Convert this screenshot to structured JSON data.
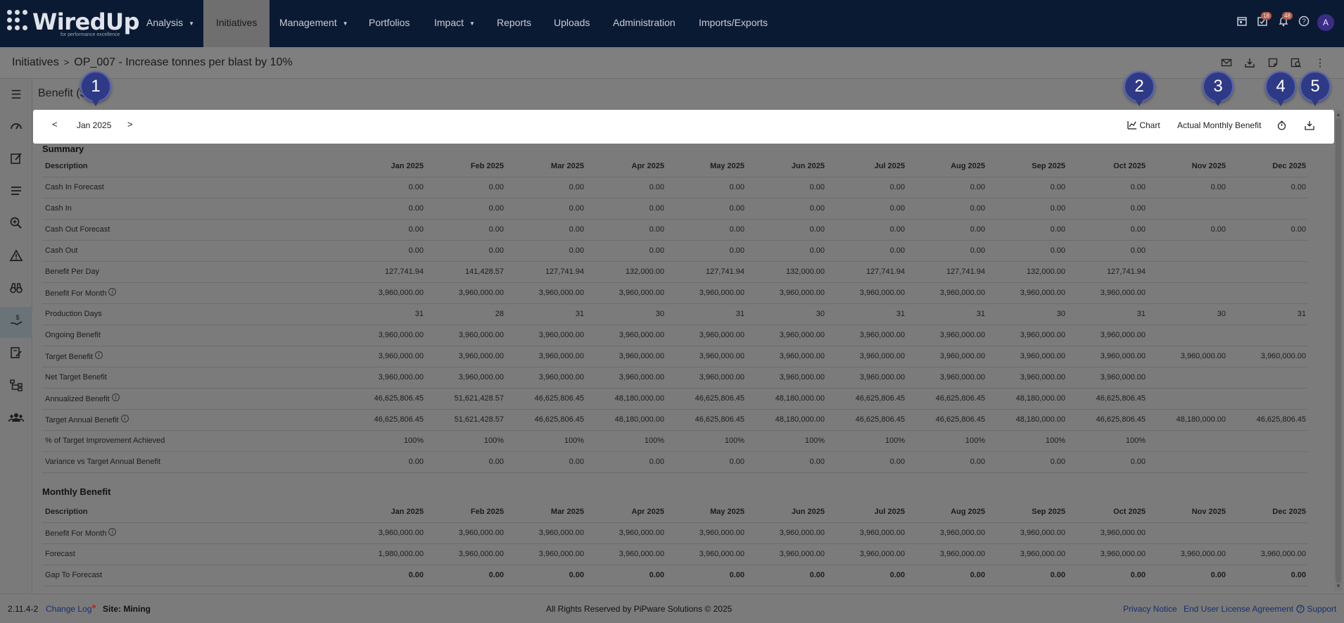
{
  "nav": {
    "logo": "WiredUp",
    "logo_tagline": "for performance excellence",
    "items": [
      {
        "label": "Analysis",
        "dropdown": true
      },
      {
        "label": "Initiatives",
        "active": true
      },
      {
        "label": "Management",
        "dropdown": true
      },
      {
        "label": "Portfolios"
      },
      {
        "label": "Impact",
        "dropdown": true
      },
      {
        "label": "Reports"
      },
      {
        "label": "Uploads"
      },
      {
        "label": "Administration"
      },
      {
        "label": "Imports/Exports"
      }
    ],
    "icons": [
      "calendar-icon",
      "tasks-icon",
      "bell-icon",
      "help-icon"
    ],
    "tasks_badge": "18",
    "notifications_badge": "48",
    "avatar_initial": "A"
  },
  "breadcrumb": {
    "root": "Initiatives",
    "current": "OP_007 - Increase tonnes per blast by 10%"
  },
  "panel_title": "Benefit ($)",
  "toolbar": {
    "period": "Jan 2025",
    "chart_label": "Chart",
    "view_label": "Actual Monthly Benefit"
  },
  "markers": [
    "1",
    "2",
    "3",
    "4",
    "5"
  ],
  "summary": {
    "title": "Summary",
    "description_header": "Description",
    "months": [
      "Jan 2025",
      "Feb 2025",
      "Mar 2025",
      "Apr 2025",
      "May 2025",
      "Jun 2025",
      "Jul 2025",
      "Aug 2025",
      "Sep 2025",
      "Oct 2025",
      "Nov 2025",
      "Dec 2025"
    ],
    "rows": [
      {
        "label": "Cash In Forecast",
        "info": false,
        "values": [
          "0.00",
          "0.00",
          "0.00",
          "0.00",
          "0.00",
          "0.00",
          "0.00",
          "0.00",
          "0.00",
          "0.00",
          "0.00",
          "0.00"
        ]
      },
      {
        "label": "Cash In",
        "info": false,
        "values": [
          "0.00",
          "0.00",
          "0.00",
          "0.00",
          "0.00",
          "0.00",
          "0.00",
          "0.00",
          "0.00",
          "0.00",
          "",
          ""
        ]
      },
      {
        "label": "Cash Out Forecast",
        "info": false,
        "values": [
          "0.00",
          "0.00",
          "0.00",
          "0.00",
          "0.00",
          "0.00",
          "0.00",
          "0.00",
          "0.00",
          "0.00",
          "0.00",
          "0.00"
        ]
      },
      {
        "label": "Cash Out",
        "info": false,
        "values": [
          "0.00",
          "0.00",
          "0.00",
          "0.00",
          "0.00",
          "0.00",
          "0.00",
          "0.00",
          "0.00",
          "0.00",
          "",
          ""
        ]
      },
      {
        "label": "Benefit Per Day",
        "info": false,
        "values": [
          "127,741.94",
          "141,428.57",
          "127,741.94",
          "132,000.00",
          "127,741.94",
          "132,000.00",
          "127,741.94",
          "127,741.94",
          "132,000.00",
          "127,741.94",
          "",
          ""
        ]
      },
      {
        "label": "Benefit For Month",
        "info": true,
        "values": [
          "3,960,000.00",
          "3,960,000.00",
          "3,960,000.00",
          "3,960,000.00",
          "3,960,000.00",
          "3,960,000.00",
          "3,960,000.00",
          "3,960,000.00",
          "3,960,000.00",
          "3,960,000.00",
          "",
          ""
        ]
      },
      {
        "label": "Production Days",
        "info": false,
        "values": [
          "31",
          "28",
          "31",
          "30",
          "31",
          "30",
          "31",
          "31",
          "30",
          "31",
          "30",
          "31"
        ]
      },
      {
        "label": "Ongoing Benefit",
        "info": false,
        "values": [
          "3,960,000.00",
          "3,960,000.00",
          "3,960,000.00",
          "3,960,000.00",
          "3,960,000.00",
          "3,960,000.00",
          "3,960,000.00",
          "3,960,000.00",
          "3,960,000.00",
          "3,960,000.00",
          "",
          ""
        ]
      },
      {
        "label": "Target Benefit",
        "info": true,
        "values": [
          "3,960,000.00",
          "3,960,000.00",
          "3,960,000.00",
          "3,960,000.00",
          "3,960,000.00",
          "3,960,000.00",
          "3,960,000.00",
          "3,960,000.00",
          "3,960,000.00",
          "3,960,000.00",
          "3,960,000.00",
          "3,960,000.00"
        ]
      },
      {
        "label": "Net Target Benefit",
        "info": false,
        "values": [
          "3,960,000.00",
          "3,960,000.00",
          "3,960,000.00",
          "3,960,000.00",
          "3,960,000.00",
          "3,960,000.00",
          "3,960,000.00",
          "3,960,000.00",
          "3,960,000.00",
          "3,960,000.00",
          "",
          ""
        ]
      },
      {
        "label": "Annualized Benefit",
        "info": true,
        "values": [
          "46,625,806.45",
          "51,621,428.57",
          "46,625,806.45",
          "48,180,000.00",
          "46,625,806.45",
          "48,180,000.00",
          "46,625,806.45",
          "46,625,806.45",
          "48,180,000.00",
          "46,625,806.45",
          "",
          ""
        ]
      },
      {
        "label": "Target Annual Benefit",
        "info": true,
        "values": [
          "46,625,806.45",
          "51,621,428.57",
          "46,625,806.45",
          "48,180,000.00",
          "46,625,806.45",
          "48,180,000.00",
          "46,625,806.45",
          "46,625,806.45",
          "48,180,000.00",
          "46,625,806.45",
          "48,180,000.00",
          "46,625,806.45"
        ]
      },
      {
        "label": "% of Target Improvement Achieved",
        "info": false,
        "values": [
          "100%",
          "100%",
          "100%",
          "100%",
          "100%",
          "100%",
          "100%",
          "100%",
          "100%",
          "100%",
          "",
          ""
        ]
      },
      {
        "label": "Variance vs Target Annual Benefit",
        "info": false,
        "values": [
          "0.00",
          "0.00",
          "0.00",
          "0.00",
          "0.00",
          "0.00",
          "0.00",
          "0.00",
          "0.00",
          "0.00",
          "",
          ""
        ]
      }
    ]
  },
  "monthly": {
    "title": "Monthly Benefit",
    "description_header": "Description",
    "months": [
      "Jan 2025",
      "Feb 2025",
      "Mar 2025",
      "Apr 2025",
      "May 2025",
      "Jun 2025",
      "Jul 2025",
      "Aug 2025",
      "Sep 2025",
      "Oct 2025",
      "Nov 2025",
      "Dec 2025"
    ],
    "rows": [
      {
        "label": "Benefit For Month",
        "info": true,
        "bold": false,
        "values": [
          "3,960,000.00",
          "3,960,000.00",
          "3,960,000.00",
          "3,960,000.00",
          "3,960,000.00",
          "3,960,000.00",
          "3,960,000.00",
          "3,960,000.00",
          "3,960,000.00",
          "3,960,000.00",
          "",
          ""
        ]
      },
      {
        "label": "Forecast",
        "info": false,
        "bold": false,
        "values": [
          "1,980,000.00",
          "3,960,000.00",
          "3,960,000.00",
          "3,960,000.00",
          "3,960,000.00",
          "3,960,000.00",
          "3,960,000.00",
          "3,960,000.00",
          "3,960,000.00",
          "3,960,000.00",
          "3,960,000.00",
          "3,960,000.00"
        ]
      },
      {
        "label": "Gap To Forecast",
        "info": false,
        "bold": true,
        "values": [
          "0.00",
          "0.00",
          "0.00",
          "0.00",
          "0.00",
          "0.00",
          "0.00",
          "0.00",
          "0.00",
          "0.00",
          "0.00",
          "0.00"
        ]
      }
    ]
  },
  "footer": {
    "version": "2.11.4-2",
    "changelog": "Change Log",
    "site": "Site: Mining",
    "copyright": "All Rights Reserved by PiPware Solutions © 2025",
    "privacy": "Privacy Notice",
    "eula": "End User License Agreement",
    "support": "Support"
  }
}
